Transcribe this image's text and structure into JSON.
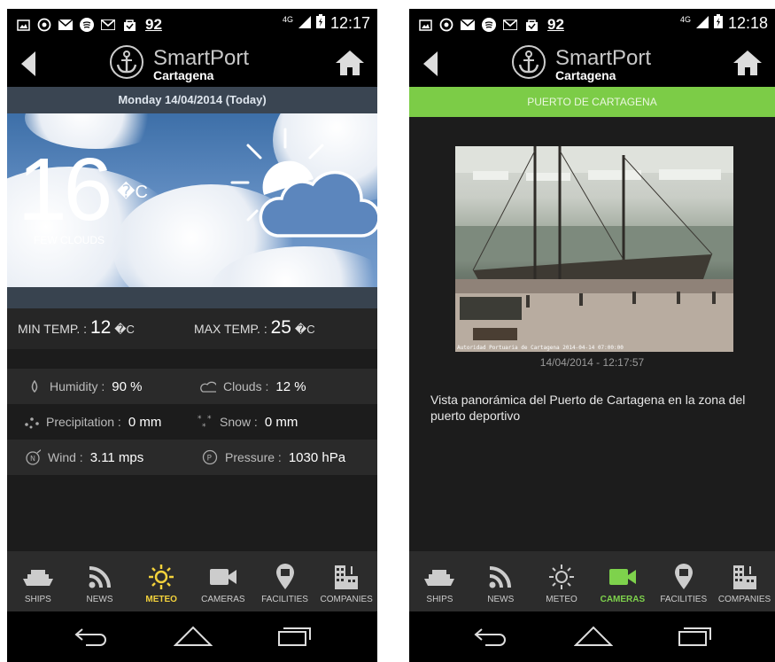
{
  "status_left": {
    "badge": "92"
  },
  "status_right_left": {
    "network": "4G",
    "time": "12:17"
  },
  "status_right_right": {
    "network": "4G",
    "time": "12:18"
  },
  "app": {
    "title": "SmartPort",
    "subtitle": "Cartagena"
  },
  "meteo": {
    "date": "Monday 14/04/2014 (Today)",
    "temperature": "16",
    "temp_unit": "�C",
    "condition": "FEW CLOUDS",
    "min_label": "MIN TEMP. :",
    "min_value": "12",
    "max_label": "MAX TEMP. :",
    "max_value": "25",
    "unit_small": "�C",
    "details": [
      {
        "label": "Humidity :",
        "value": "90 %",
        "icon": "drop-icon"
      },
      {
        "label": "Clouds :",
        "value": "12 %",
        "icon": "cloud-icon"
      },
      {
        "label": "Precipitation :",
        "value": "0 mm",
        "icon": "rain-icon"
      },
      {
        "label": "Snow :",
        "value": "0 mm",
        "icon": "snow-icon"
      },
      {
        "label": "Wind :",
        "value": "3.11 mps",
        "icon": "wind-icon"
      },
      {
        "label": "Pressure :",
        "value": "1030 hPa",
        "icon": "pressure-icon"
      }
    ]
  },
  "tabs": [
    "SHIPS",
    "NEWS",
    "METEO",
    "CAMERAS",
    "FACILITIES",
    "COMPANIES"
  ],
  "camera": {
    "location": "PUERTO DE CARTAGENA",
    "stamp": "Autoridad Portuaria de Cartagena 2014-04-14 07:00:00",
    "timestamp": "14/04/2014 - 12:17:57",
    "description": "Vista panorámica del Puerto de Cartagena en la zona del puerto deportivo"
  },
  "colors": {
    "meteo_active": "#f3d23c",
    "cameras_active": "#7ed24c",
    "port_band": "#7ccc47"
  }
}
